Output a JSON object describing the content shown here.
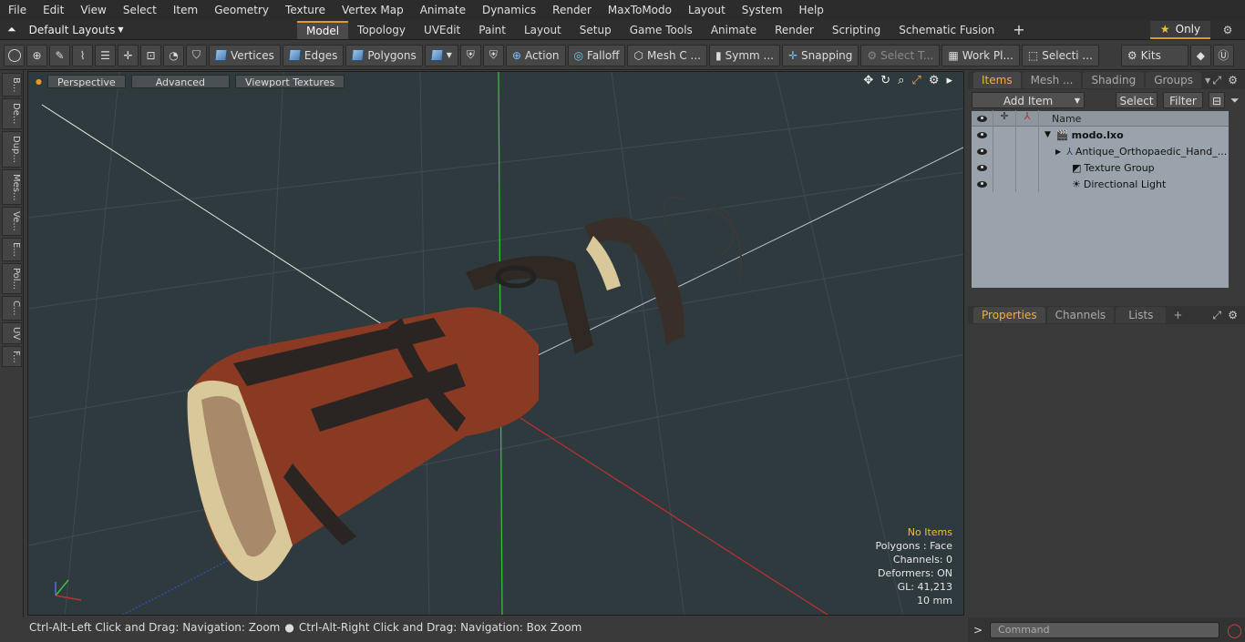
{
  "menu": [
    "File",
    "Edit",
    "View",
    "Select",
    "Item",
    "Geometry",
    "Texture",
    "Vertex Map",
    "Animate",
    "Dynamics",
    "Render",
    "MaxToModo",
    "Layout",
    "System",
    "Help"
  ],
  "layouts_label": "Default Layouts",
  "tabs": [
    "Model",
    "Topology",
    "UVEdit",
    "Paint",
    "Layout",
    "Setup",
    "Game Tools",
    "Animate",
    "Render",
    "Scripting",
    "Schematic Fusion"
  ],
  "active_tab": "Model",
  "only_label": "Only",
  "toolbar": {
    "vertices": "Vertices",
    "edges": "Edges",
    "polygons": "Polygons",
    "action": "Action",
    "falloff": "Falloff",
    "mesh": "Mesh C ...",
    "symm": "Symm ...",
    "snapping": "Snapping",
    "select_t": "Select T...",
    "workpl": "Work Pl...",
    "selecti": "Selecti ...",
    "kits": "Kits"
  },
  "left_tabs": [
    "B...",
    "De...",
    "Dup...",
    "Mes...",
    "Ve...",
    "E...",
    "Pol...",
    "C...",
    "UV",
    "F..."
  ],
  "viewport": {
    "perspective": "Perspective",
    "advanced": "Advanced",
    "textures": "Viewport Textures"
  },
  "stats": {
    "selection": "No Items",
    "polygons": "Polygons : Face",
    "channels": "Channels: 0",
    "deformers": "Deformers: ON",
    "gl": "GL: 41,213",
    "scale": "10 mm"
  },
  "items_panel": {
    "tabs": [
      "Items",
      "Mesh ...",
      "Shading",
      "Groups"
    ],
    "add_item": "Add Item",
    "select": "Select",
    "filter": "Filter",
    "name_col": "Name",
    "rows": [
      "modo.lxo",
      "Antique_Orthopaedic_Hand_...",
      "Texture Group",
      "Directional Light"
    ]
  },
  "props_panel": {
    "tabs": [
      "Properties",
      "Channels",
      "Lists"
    ]
  },
  "status": {
    "hint1": "Ctrl-Alt-Left Click and Drag: Navigation: Zoom",
    "hint2": "Ctrl-Alt-Right Click and Drag: Navigation: Box Zoom"
  },
  "command_placeholder": "Command",
  "colors": {
    "accent": "#e09a2a",
    "active_tab_text": "#f0b040",
    "stats_highlight": "#f0c030"
  }
}
